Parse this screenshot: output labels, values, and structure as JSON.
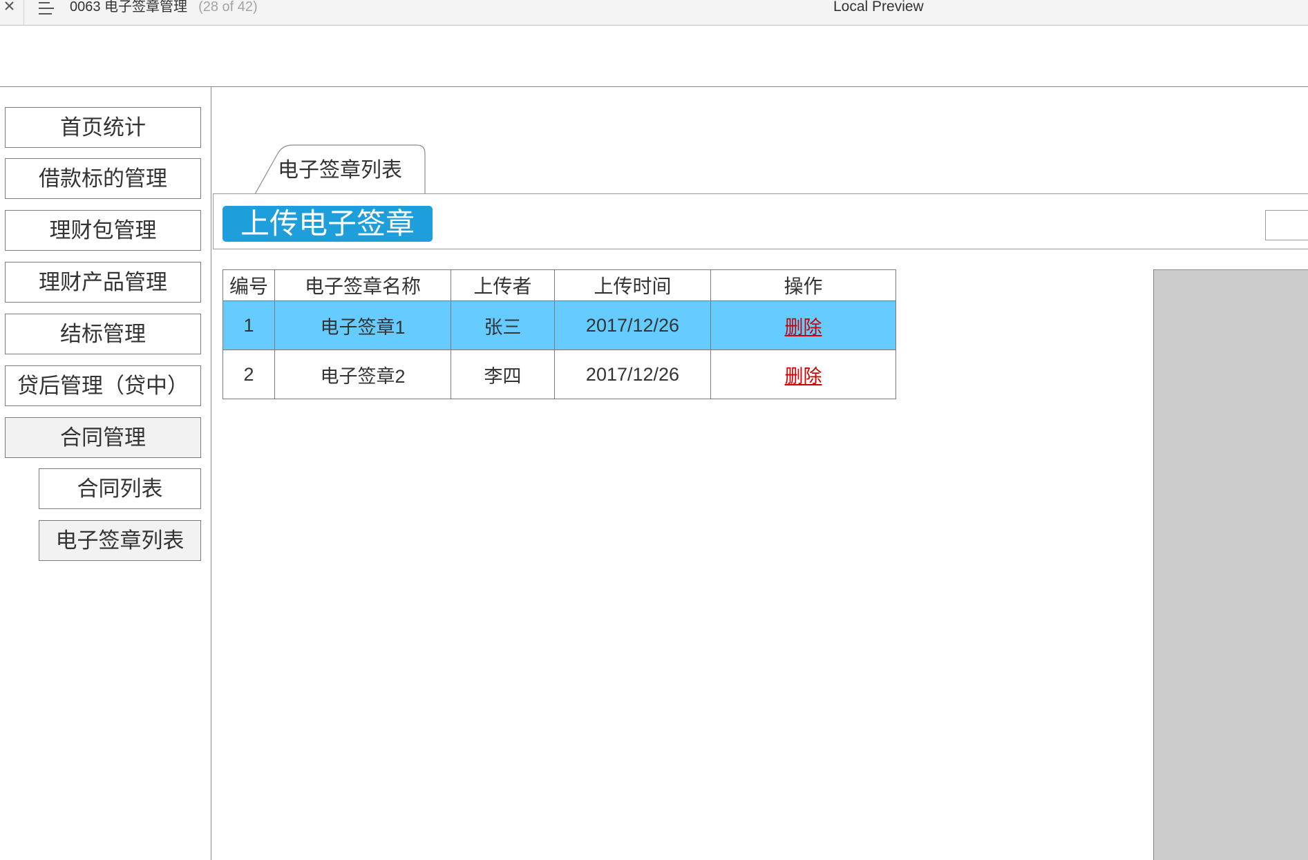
{
  "window": {
    "title": "0063 电子签章管理",
    "page_counter": "(28 of 42)",
    "preview_label": "Local Preview",
    "icons": {
      "close": "close-icon",
      "menu": "menu-icon"
    }
  },
  "sidebar": {
    "items": [
      {
        "label": "首页统计",
        "active": false,
        "submenu": false
      },
      {
        "label": "借款标的管理",
        "active": false,
        "submenu": false
      },
      {
        "label": "理财包管理",
        "active": false,
        "submenu": false
      },
      {
        "label": "理财产品管理",
        "active": false,
        "submenu": false
      },
      {
        "label": "结标管理",
        "active": false,
        "submenu": false
      },
      {
        "label": "贷后管理（贷中）",
        "active": false,
        "submenu": false
      },
      {
        "label": "合同管理",
        "active": true,
        "submenu": false
      },
      {
        "label": "合同列表",
        "active": false,
        "submenu": true
      },
      {
        "label": "电子签章列表",
        "active": true,
        "submenu": true
      }
    ]
  },
  "main": {
    "tab": {
      "label": "电子签章列表"
    },
    "upload_button": {
      "label": "上传电子签章"
    },
    "table": {
      "columns": [
        "编号",
        "电子签章名称",
        "上传者",
        "上传时间",
        "操作"
      ],
      "rows": [
        {
          "id": "1",
          "name": "电子签章1",
          "uploader": "张三",
          "time": "2017/12/26",
          "action": "删除",
          "highlighted": true
        },
        {
          "id": "2",
          "name": "电子签章2",
          "uploader": "李四",
          "time": "2017/12/26",
          "action": "删除",
          "highlighted": false
        }
      ]
    }
  },
  "colors": {
    "accent": "#1e9fdb",
    "highlight_row": "#66ccff",
    "danger_link": "#cc0000",
    "active_nav": "#f2f2f2",
    "side_panel": "#cccccc"
  }
}
